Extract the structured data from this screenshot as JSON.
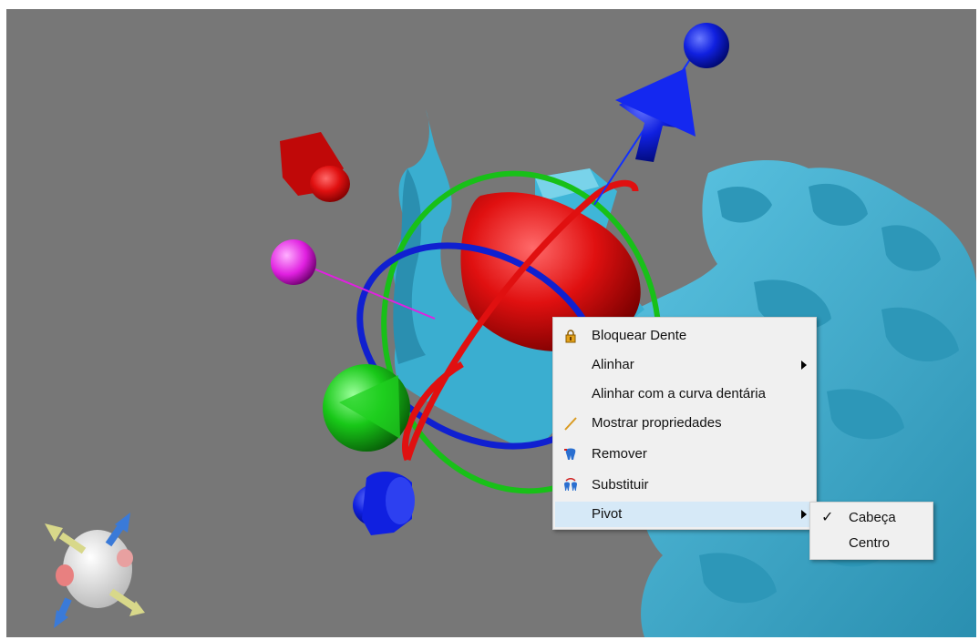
{
  "context_menu": {
    "items": [
      {
        "label": "Bloquear Dente",
        "icon": "lock-icon"
      },
      {
        "label": "Alinhar",
        "submenu": true
      },
      {
        "label": "Alinhar com a curva dentária"
      },
      {
        "label": "Mostrar propriedades",
        "icon": "pencil-icon"
      },
      {
        "label": "Remover",
        "icon": "tooth-remove-icon"
      },
      {
        "label": "Substituir",
        "icon": "tooth-replace-icon"
      },
      {
        "label": "Pivot",
        "submenu": true,
        "highlighted": true
      }
    ]
  },
  "pivot_submenu": {
    "items": [
      {
        "label": "Cabeça",
        "checked": true,
        "check_glyph": "✓"
      },
      {
        "label": "Centro",
        "checked": false
      }
    ]
  },
  "colors": {
    "viewport_bg": "#777777",
    "model": "#37a9cc",
    "gizmo_x": "#e01010",
    "gizmo_y": "#10c020",
    "gizmo_z": "#1020e0",
    "pivot_sphere": "#e020e0",
    "menu_bg": "#f0f0f0",
    "menu_highlight": "#d6e9f7"
  }
}
